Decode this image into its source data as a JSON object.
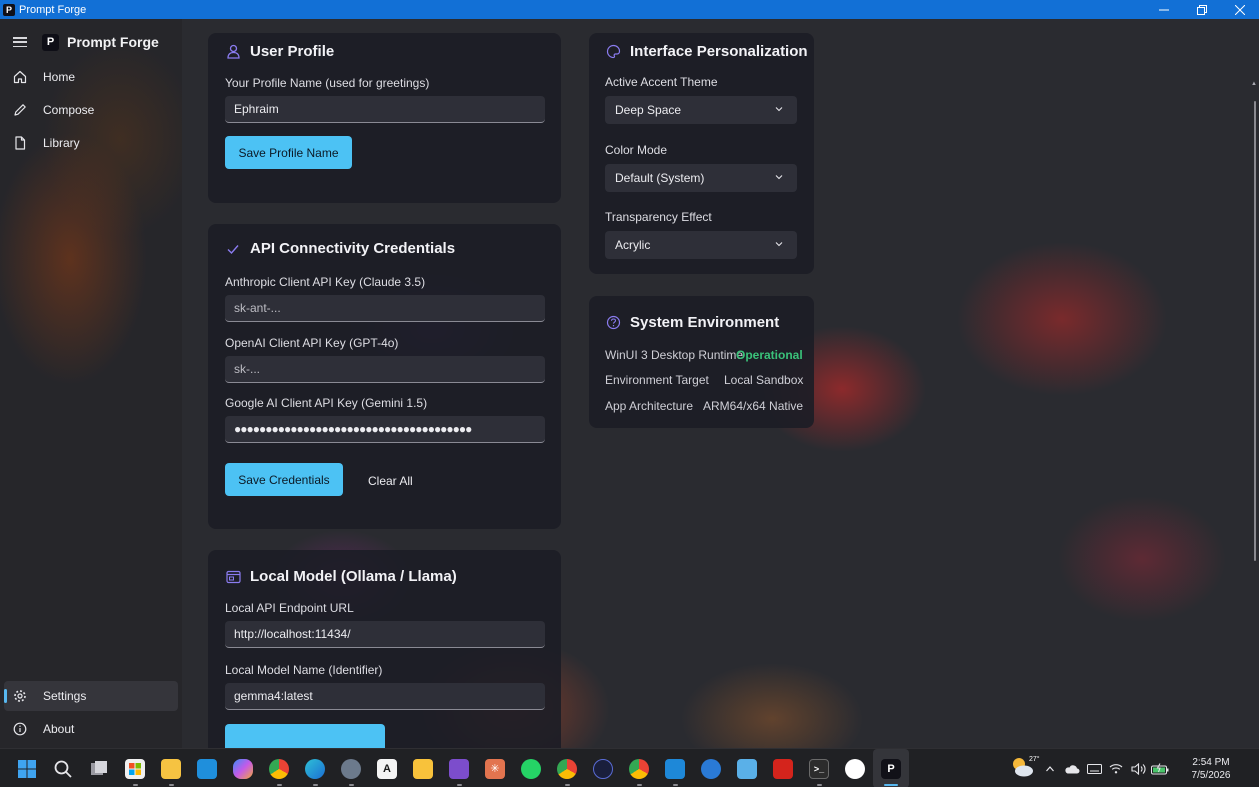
{
  "window": {
    "title": "Prompt Forge"
  },
  "sidebar": {
    "app_name": "Prompt Forge",
    "logo_letter": "P",
    "items": [
      {
        "label": "Home",
        "icon": "home-icon"
      },
      {
        "label": "Compose",
        "icon": "pencil-icon"
      },
      {
        "label": "Library",
        "icon": "document-icon"
      }
    ],
    "footer_items": [
      {
        "label": "Settings",
        "icon": "gear-icon",
        "active": true
      },
      {
        "label": "About",
        "icon": "info-icon"
      }
    ]
  },
  "user_profile": {
    "title": "User Profile",
    "name_label": "Your Profile Name (used for greetings)",
    "name_value": "Ephraim",
    "save_label": "Save Profile Name"
  },
  "api": {
    "title": "API Connectivity Credentials",
    "anthropic_label": "Anthropic Client API Key (Claude 3.5)",
    "anthropic_placeholder": "sk-ant-...",
    "openai_label": "OpenAI Client API Key (GPT-4o)",
    "openai_placeholder": "sk-...",
    "google_label": "Google AI Client API Key (Gemini 1.5)",
    "google_value": "●●●●●●●●●●●●●●●●●●●●●●●●●●●●●●●●●●●●●●",
    "save_label": "Save Credentials",
    "clear_label": "Clear All"
  },
  "local_model": {
    "title": "Local Model (Ollama / Llama)",
    "endpoint_label": "Local API Endpoint URL",
    "endpoint_value": "http://localhost:11434/",
    "model_label": "Local Model Name (Identifier)",
    "model_value": "gemma4:latest"
  },
  "personalization": {
    "title": "Interface Personalization",
    "accent_label": "Active Accent Theme",
    "accent_value": "Deep Space",
    "color_mode_label": "Color Mode",
    "color_mode_value": "Default (System)",
    "transparency_label": "Transparency Effect",
    "transparency_value": "Acrylic"
  },
  "environment": {
    "title": "System Environment",
    "rows": [
      {
        "key": "WinUI 3 Desktop Runtime",
        "value": "Operational"
      },
      {
        "key": "Environment Target",
        "value": "Local Sandbox"
      },
      {
        "key": "App Architecture",
        "value": "ARM64/x64 Native"
      }
    ]
  },
  "taskbar": {
    "weather_temp": "27°",
    "time": "2:54 PM",
    "date": "7/5/2026",
    "active_app_letter": "P"
  },
  "colors": {
    "accent": "#4cc2f4",
    "title_bar": "#1270d6",
    "status_ok": "#3ac27a"
  }
}
